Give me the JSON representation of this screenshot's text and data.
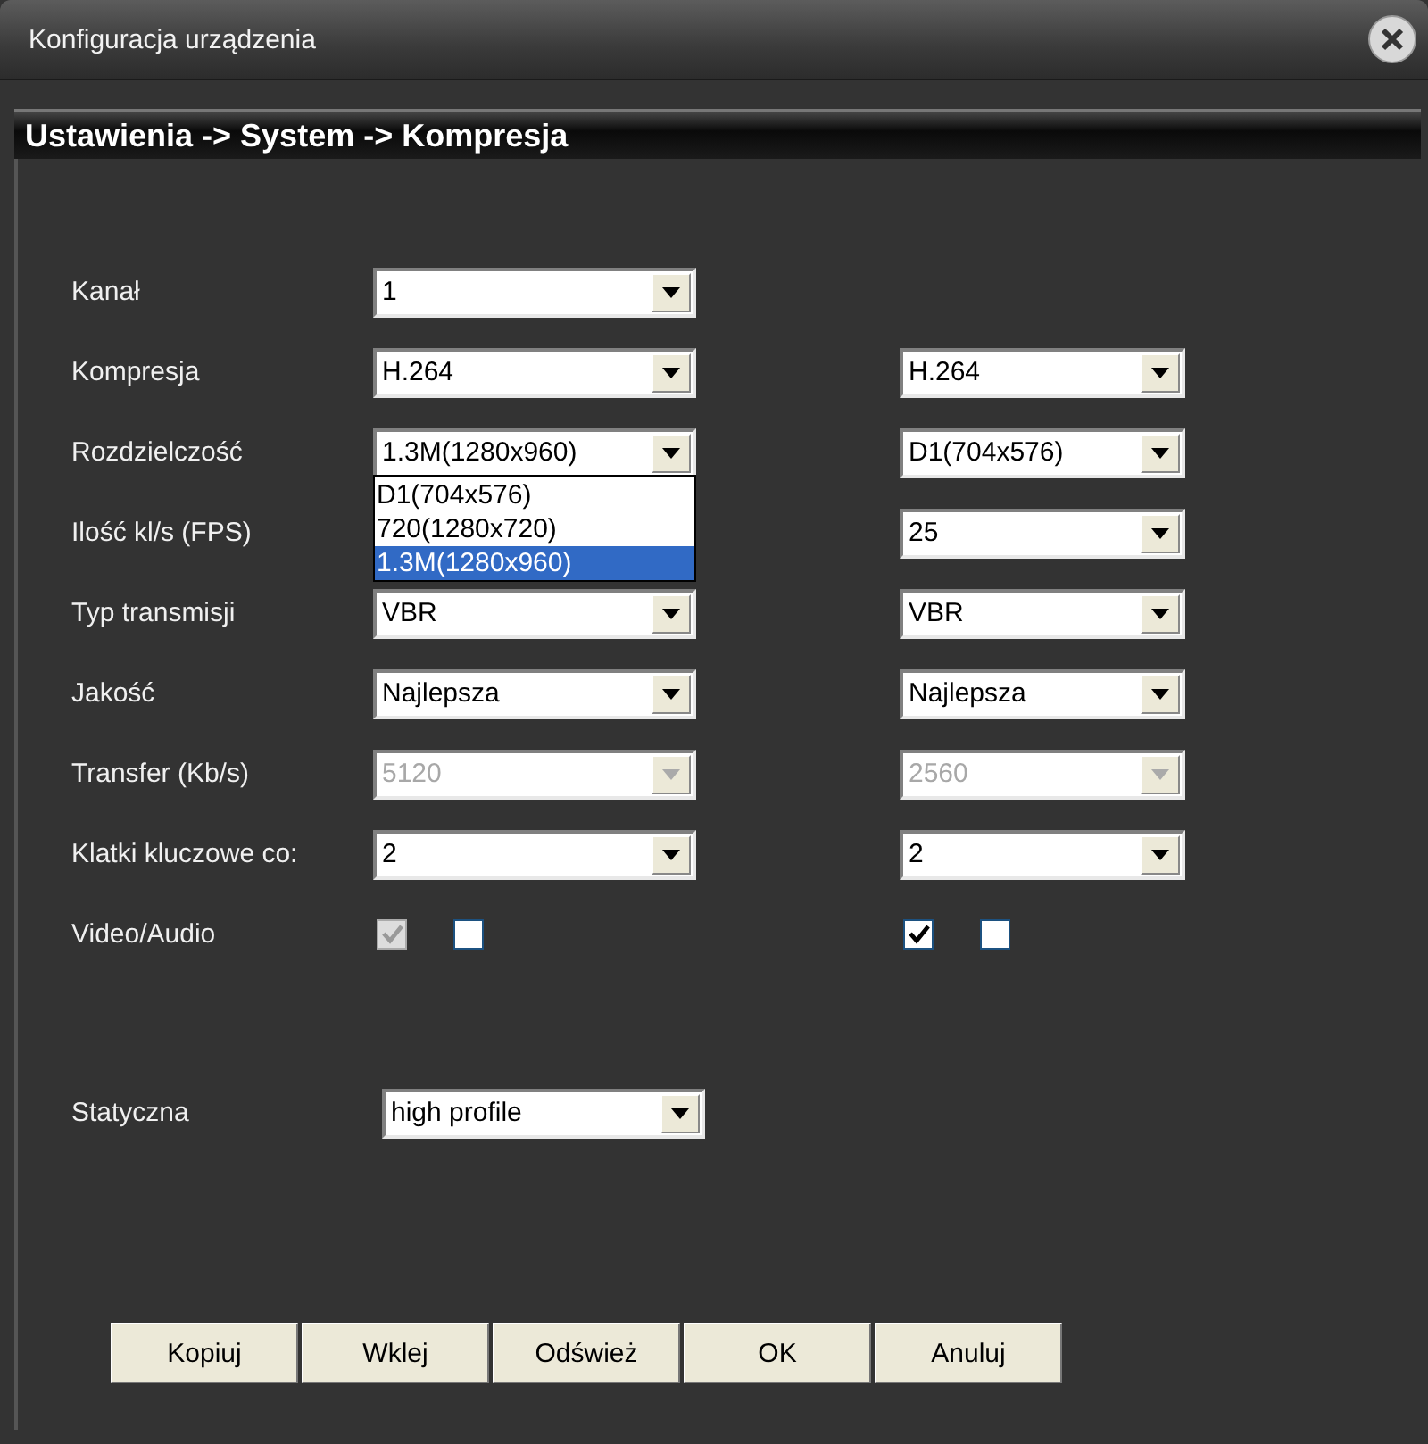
{
  "window": {
    "title": "Konfiguracja urządzenia"
  },
  "breadcrumb": "Ustawienia -> System -> Kompresja",
  "rows": [
    {
      "label": "Kanał",
      "kind": "select",
      "main": {
        "value": "1",
        "disabled": false
      }
    },
    {
      "label": "Kompresja",
      "kind": "select",
      "main": {
        "value": "H.264",
        "disabled": false
      },
      "extra": {
        "value": "H.264",
        "disabled": false
      }
    },
    {
      "label": "Rozdzielczość",
      "kind": "select",
      "main": {
        "value": "1.3M(1280x960)",
        "disabled": false,
        "open": true,
        "options": [
          {
            "label": "D1(704x576)",
            "selected": false
          },
          {
            "label": "720(1280x720)",
            "selected": false
          },
          {
            "label": "1.3M(1280x960)",
            "selected": true
          }
        ]
      },
      "extra": {
        "value": "D1(704x576)",
        "disabled": false
      }
    },
    {
      "label": "Ilość kl/s (FPS)",
      "kind": "select",
      "extra": {
        "value": "25",
        "disabled": false
      }
    },
    {
      "label": "Typ transmisji",
      "kind": "select",
      "main": {
        "value": "VBR",
        "disabled": false
      },
      "extra": {
        "value": "VBR",
        "disabled": false
      }
    },
    {
      "label": "Jakość",
      "kind": "select",
      "main": {
        "value": "Najlepsza",
        "disabled": false
      },
      "extra": {
        "value": "Najlepsza",
        "disabled": false
      }
    },
    {
      "label": "Transfer (Kb/s)",
      "kind": "select",
      "main": {
        "value": "5120",
        "disabled": true
      },
      "extra": {
        "value": "2560",
        "disabled": true
      }
    },
    {
      "label": "Klatki kluczowe co:",
      "kind": "select",
      "main": {
        "value": "2",
        "disabled": false
      },
      "extra": {
        "value": "2",
        "disabled": false
      }
    },
    {
      "label": "Video/Audio",
      "kind": "checkboxes",
      "main": [
        {
          "checked": true,
          "disabled": true
        },
        {
          "checked": false,
          "disabled": false
        }
      ],
      "extra": [
        {
          "checked": true,
          "disabled": false
        },
        {
          "checked": false,
          "disabled": false
        }
      ]
    }
  ],
  "static_row": {
    "label": "Statyczna",
    "value": "high profile"
  },
  "buttons": [
    "Kopiuj",
    "Wklej",
    "Odśwież",
    "OK",
    "Anuluj"
  ]
}
